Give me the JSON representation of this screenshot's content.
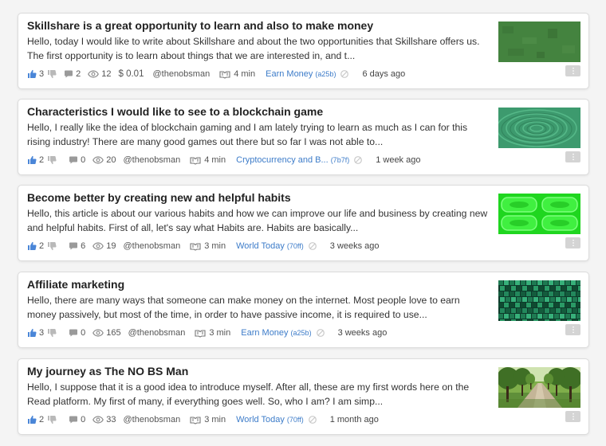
{
  "posts": [
    {
      "title": "Skillshare is a great opportunity to learn and also to make money",
      "excerpt": "Hello, today I would like to write about Skillshare and about the two opportunities that Skillshare of­fers us. The first opportunity is to learn about things that we are interested in, and t...",
      "upvotes": "3",
      "comments": "2",
      "views": "12",
      "earnings": "$ 0.01",
      "author": "@thenobsman",
      "read_time": "4 min",
      "category": "Earn Money",
      "category_code": "(a25b)",
      "age": "6 days ago",
      "thumbnail": "green-texture"
    },
    {
      "title": "Characteristics I would like to see to a blockchain game",
      "excerpt": "Hello, I really like the idea of blockchain gaming and I am lately trying to learn as much as I can for this rising industry! There are many good games out there but so far I was not able to...",
      "upvotes": "2",
      "comments": "0",
      "views": "20",
      "author": "@thenobsman",
      "read_time": "4 min",
      "category": "Cryptocurrency and B...",
      "category_code": "(7b7f)",
      "age": "1 week ago",
      "thumbnail": "water-ripple"
    },
    {
      "title": "Become better by creating new and helpful habits",
      "excerpt": "Hello, this article is about our various habits and how we can improve our life and business by creating new and helpful habits. First of all, let's say what Habits are. Habits are basically...",
      "upvotes": "2",
      "comments": "6",
      "views": "19",
      "author": "@thenobsman",
      "read_time": "3 min",
      "category": "World Today",
      "category_code": "(70ff)",
      "age": "3 weeks ago",
      "thumbnail": "green-glow-tiles"
    },
    {
      "title": "Affiliate marketing",
      "excerpt": "Hello, there are many ways that someone can make money on the internet. Most people love to earn money passively, but most of the time, in order to have passive income, it is required to use...",
      "upvotes": "3",
      "comments": "0",
      "views": "165",
      "author": "@thenobsman",
      "read_time": "3 min",
      "category": "Earn Money",
      "category_code": "(a25b)",
      "age": "3 weeks ago",
      "thumbnail": "cube-mosaic"
    },
    {
      "title": "My journey as The NO BS Man",
      "excerpt": "Hello, I suppose that it is a good idea to introduce myself. After all, these are my first words here on the Read platform. My first of many, if everything goes well. So, who I am? I am simp...",
      "upvotes": "2",
      "comments": "0",
      "views": "33",
      "author": "@thenobsman",
      "read_time": "3 min",
      "category": "World Today",
      "category_code": "(70ff)",
      "age": "1 month ago",
      "thumbnail": "tree-lined-road"
    }
  ],
  "colors": {
    "upvote": "#4a86d8",
    "downvote": "#b9b9b9",
    "category_link": "#3d7cc9",
    "card_border": "#dcdcdc"
  },
  "icons": {
    "upvote": "thumbs-up-icon",
    "downvote": "thumbs-down-icon",
    "comments": "comment-bubble-icon",
    "views": "eye-icon",
    "read_time": "reading-icon",
    "category_status": "circle-slash-icon",
    "menu": "more-icon"
  }
}
